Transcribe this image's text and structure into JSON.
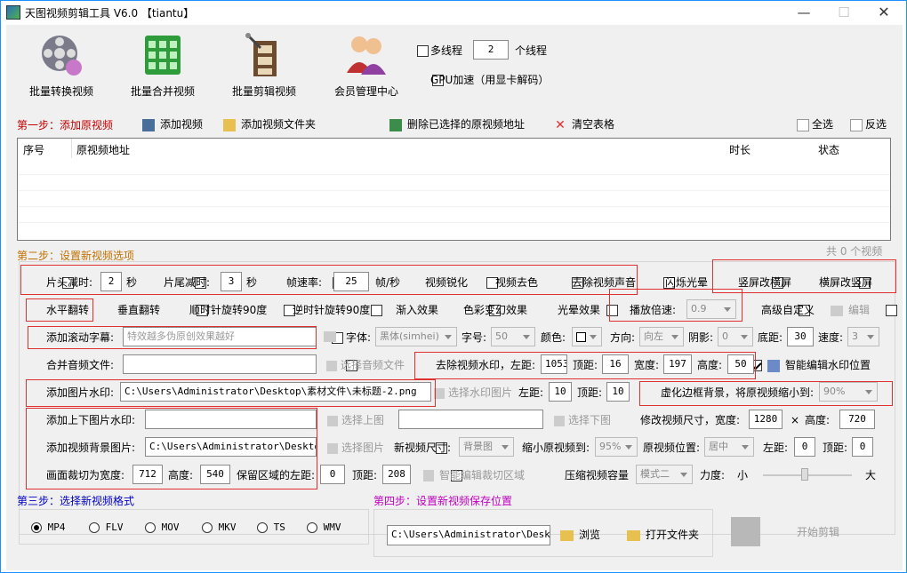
{
  "window": {
    "title": "天图视频剪辑工具 V6.0  【tiantu】",
    "min": "—",
    "max": "☐",
    "close": "✕"
  },
  "toolbar": {
    "batch_convert": "批量转换视频",
    "batch_merge": "批量合并视频",
    "batch_cut": "批量剪辑视频",
    "member": "会员管理中心",
    "multithread_label": "多线程",
    "thread_count": "2",
    "thread_unit": "个线程",
    "gpu_label": "GPU加速（用显卡解码）"
  },
  "step1": {
    "title": "第一步：添加原视频",
    "add_video": "添加视频",
    "add_folder": "添加视频文件夹",
    "delete_selected": "删除已选择的原视频地址",
    "clear_table": "清空表格",
    "select_all": "全选",
    "invert": "反选",
    "columns": [
      "序号",
      "原视频地址",
      "时长",
      "状态"
    ],
    "count_text": "共 0 个视频"
  },
  "step2": {
    "title": "第二步：设置新视频选项",
    "head_cut": "片头减时:",
    "head_val": "2",
    "sec1": "秒",
    "tail_cut": "片尾减时:",
    "tail_val": "3",
    "sec2": "秒",
    "framerate": "帧速率:",
    "framerate_val": "25",
    "fps_unit": "帧/秒",
    "sharpen": "视频锐化",
    "decolor": "视频去色",
    "mute": "去除视频声音",
    "flash": "闪烁光晕",
    "v2h": "竖屏改横屏",
    "h2v": "横屏改竖屏",
    "hflip": "水平翻转",
    "vflip": "垂直翻转",
    "rot_cw": "顺时针旋转90度",
    "rot_ccw": "逆时针旋转90度",
    "fade": "渐入效果",
    "color_fx": "色彩变幻效果",
    "light_fx": "光晕效果",
    "speed": "播放倍速:",
    "speed_val": "0.9",
    "advanced": "高级自定义",
    "edit": "编辑",
    "scroll_sub": "添加滚动字幕:",
    "scroll_text": "特效越多伪原创效果越好",
    "font_label": "字体:",
    "font_val": "黑体(simhei)",
    "size_label": "字号:",
    "size_val": "50",
    "color_label": "颜色:",
    "dir_label": "方向:",
    "dir_val": "向左",
    "shadow_label": "阴影:",
    "shadow_val": "0",
    "bottom_label": "底距:",
    "bottom_val": "30",
    "speed2_label": "速度:",
    "speed2_val": "3",
    "merge_audio": "合并音频文件:",
    "select_audio": "选择音频文件",
    "remove_wm": "去除视频水印，左距:",
    "wm_left": "1053",
    "wm_top_label": "顶距:",
    "wm_top": "16",
    "wm_w_label": "宽度:",
    "wm_w": "197",
    "wm_h_label": "高度:",
    "wm_h": "50",
    "smart_wm": "智能编辑水印位置",
    "img_wm": "添加图片水印:",
    "img_wm_path": "C:\\Users\\Administrator\\Desktop\\素材文件\\未标题-2.png",
    "select_wm_img": "选择水印图片",
    "img_left_label": "左距:",
    "img_left": "10",
    "img_top_label": "顶距:",
    "img_top": "10",
    "blur_bg": "虚化边框背景，将原视频缩小到:",
    "blur_val": "90%",
    "topbottom_img": "添加上下图片水印:",
    "select_top": "选择上图",
    "select_bottom": "选择下图",
    "resize": "修改视频尺寸，宽度:",
    "resize_w": "1280",
    "times": "×",
    "resize_h_label": "高度:",
    "resize_h": "720",
    "bg_img": "添加视频背景图片:",
    "bg_img_path": "C:\\Users\\Administrator\\Desktop\\q",
    "select_img": "选择图片",
    "new_size_label": "新视频尺寸:",
    "new_size_val": "背景图",
    "shrink_label": "缩小原视频到:",
    "shrink_val": "95%",
    "pos_label": "原视频位置:",
    "pos_val": "居中",
    "pos_left_label": "左距:",
    "pos_left": "0",
    "pos_top_label": "顶距:",
    "pos_top": "0",
    "crop": "画面裁切为宽度:",
    "crop_w": "712",
    "crop_h_label": "高度:",
    "crop_h": "540",
    "crop_left_label": "保留区域的左距:",
    "crop_left": "0",
    "crop_top_label": "顶距:",
    "crop_top": "208",
    "smart_crop": "智能编辑裁切区域",
    "compress": "压缩视频容量",
    "compress_val": "模式二",
    "strength_label": "力度:",
    "small": "小",
    "big": "大"
  },
  "step3": {
    "title": "第三步：选择新视频格式",
    "formats": [
      "MP4",
      "FLV",
      "MOV",
      "MKV",
      "TS",
      "WMV"
    ]
  },
  "step4": {
    "title": "第四步：设置新视频保存位置",
    "path": "C:\\Users\\Administrator\\Desktop\\",
    "browse": "浏览",
    "open_folder": "打开文件夹",
    "start": "开始剪辑"
  },
  "colors": {
    "step_red": "#c00000",
    "step_blue": "#0000c0",
    "step_magenta": "#c000c0",
    "highlight": "#e03030"
  }
}
